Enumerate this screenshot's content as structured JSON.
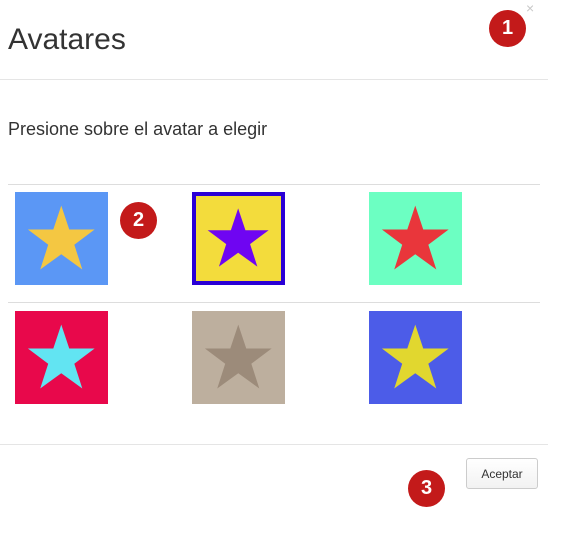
{
  "dialog": {
    "title": "Avatares",
    "close_label": "×",
    "prompt": "Presione sobre el avatar a elegir",
    "accept_label": "Aceptar"
  },
  "avatars": [
    {
      "bg": "#5b97f5",
      "star": "#f4c742",
      "selected": false
    },
    {
      "bg": "#f3dc3c",
      "star": "#6f05f2",
      "selected": true
    },
    {
      "bg": "#6cffc2",
      "star": "#e9363b",
      "selected": false
    },
    {
      "bg": "#e8084b",
      "star": "#62e4f2",
      "selected": false
    },
    {
      "bg": "#bdaf9e",
      "star": "#9c8b7a",
      "selected": false
    },
    {
      "bg": "#4c5ce8",
      "star": "#e1d72f",
      "selected": false
    }
  ],
  "selection_border_color": "#2a00d6",
  "markers": [
    {
      "label": "1",
      "color": "#c31a1a"
    },
    {
      "label": "2",
      "color": "#c31a1a"
    },
    {
      "label": "3",
      "color": "#c31a1a"
    }
  ]
}
